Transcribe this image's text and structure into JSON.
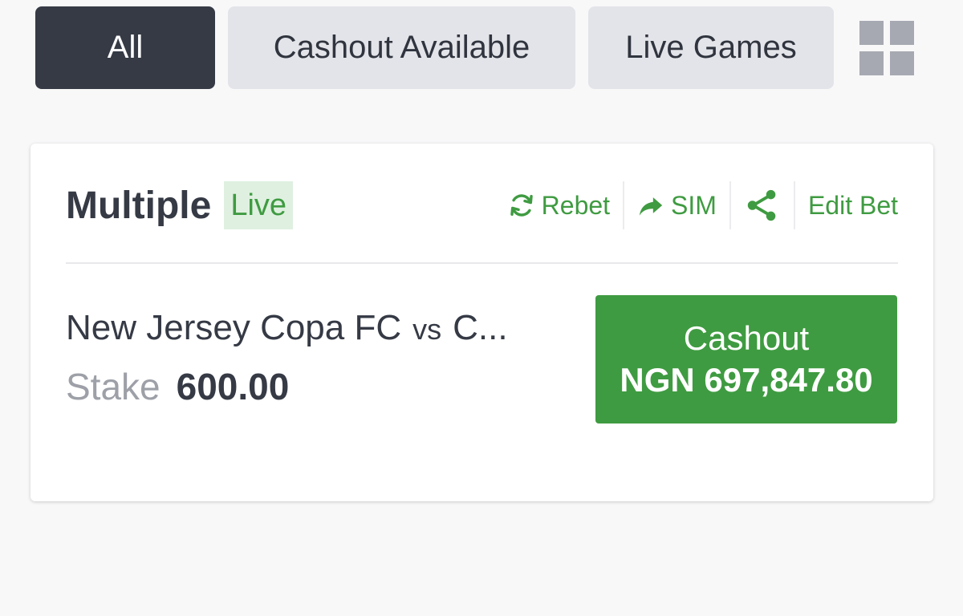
{
  "filters": {
    "tabs": [
      {
        "label": "All",
        "active": true
      },
      {
        "label": "Cashout Available",
        "active": false
      },
      {
        "label": "Live Games",
        "active": false
      }
    ],
    "view_toggle_icon": "grid-icon"
  },
  "bet": {
    "type": "Multiple",
    "status": "Live",
    "actions": {
      "rebet": "Rebet",
      "sim": "SIM",
      "edit": "Edit Bet"
    },
    "match": {
      "home": "New Jersey Copa FC",
      "vs": "vs",
      "away": "C..."
    },
    "stake_label": "Stake",
    "stake_value": "600.00",
    "cashout_label": "Cashout",
    "cashout_amount": "NGN 697,847.80"
  },
  "colors": {
    "accent_green": "#3f9b41",
    "dark_tab": "#353a45",
    "inactive_tab": "#e3e4e9"
  }
}
